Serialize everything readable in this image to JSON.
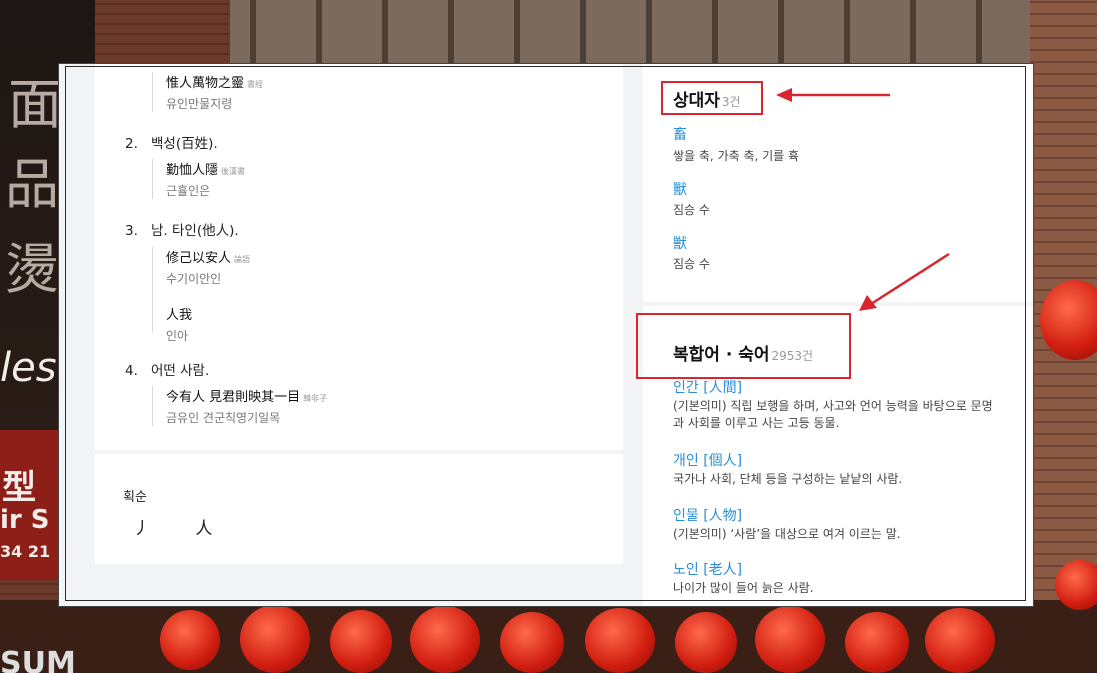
{
  "background": {
    "glyphs": [
      "面",
      "品",
      "燙"
    ],
    "sign_text": [
      "les",
      "型",
      "ir S",
      "34 21",
      "SUM"
    ]
  },
  "senses": [
    {
      "number": "",
      "examples": [
        {
          "hanja": "惟人萬物之靈",
          "source": "書經",
          "reading": "유인만물지령"
        }
      ]
    },
    {
      "number": "2.",
      "text": "백성(百姓).",
      "examples": [
        {
          "hanja": "勤恤人隱",
          "source": "後漢書",
          "reading": "근휼인은"
        }
      ]
    },
    {
      "number": "3.",
      "text": "남. 타인(他人).",
      "examples": [
        {
          "hanja": "修己以安人",
          "source": "論語",
          "reading": "수기이안인"
        },
        {
          "hanja": "人我",
          "source": "",
          "reading": "인아"
        }
      ]
    },
    {
      "number": "4.",
      "text": "어떤 사람.",
      "examples": [
        {
          "hanja": "今有人 見君則映其一目",
          "source": "韓非子",
          "reading": "금유인 견군칙영기일목"
        }
      ]
    }
  ],
  "strokes": {
    "title": "획순",
    "chars": "丿 人"
  },
  "antonyms": {
    "title": "상대자",
    "count": "3건",
    "items": [
      {
        "hanja": "畜",
        "meaning": "쌓을 축, 가축 축, 기를 휵"
      },
      {
        "hanja": "獸",
        "meaning": "짐승 수"
      },
      {
        "hanja": "獣",
        "meaning": "짐승 수"
      }
    ]
  },
  "compounds": {
    "title": "복합어 · 숙어",
    "count": "2953건",
    "items": [
      {
        "word": "인간 [人間]",
        "desc": "(기본의미) 직립 보행을 하며, 사고와 언어 능력을 바탕으로 문명과 사회를 이루고 사는 고등 동물."
      },
      {
        "word": "개인 [個人]",
        "desc": "국가나 사회, 단체 등을 구성하는 낱낱의 사람."
      },
      {
        "word": "인물 [人物]",
        "desc": "(기본의미) ‘사람’을 대상으로 여겨 이르는 말."
      },
      {
        "word": "노인 [老人]",
        "desc": "나이가 많이 들어 늙은 사람."
      }
    ]
  },
  "colors": {
    "link": "#2a8fd8",
    "highlight": "#d7262d"
  }
}
